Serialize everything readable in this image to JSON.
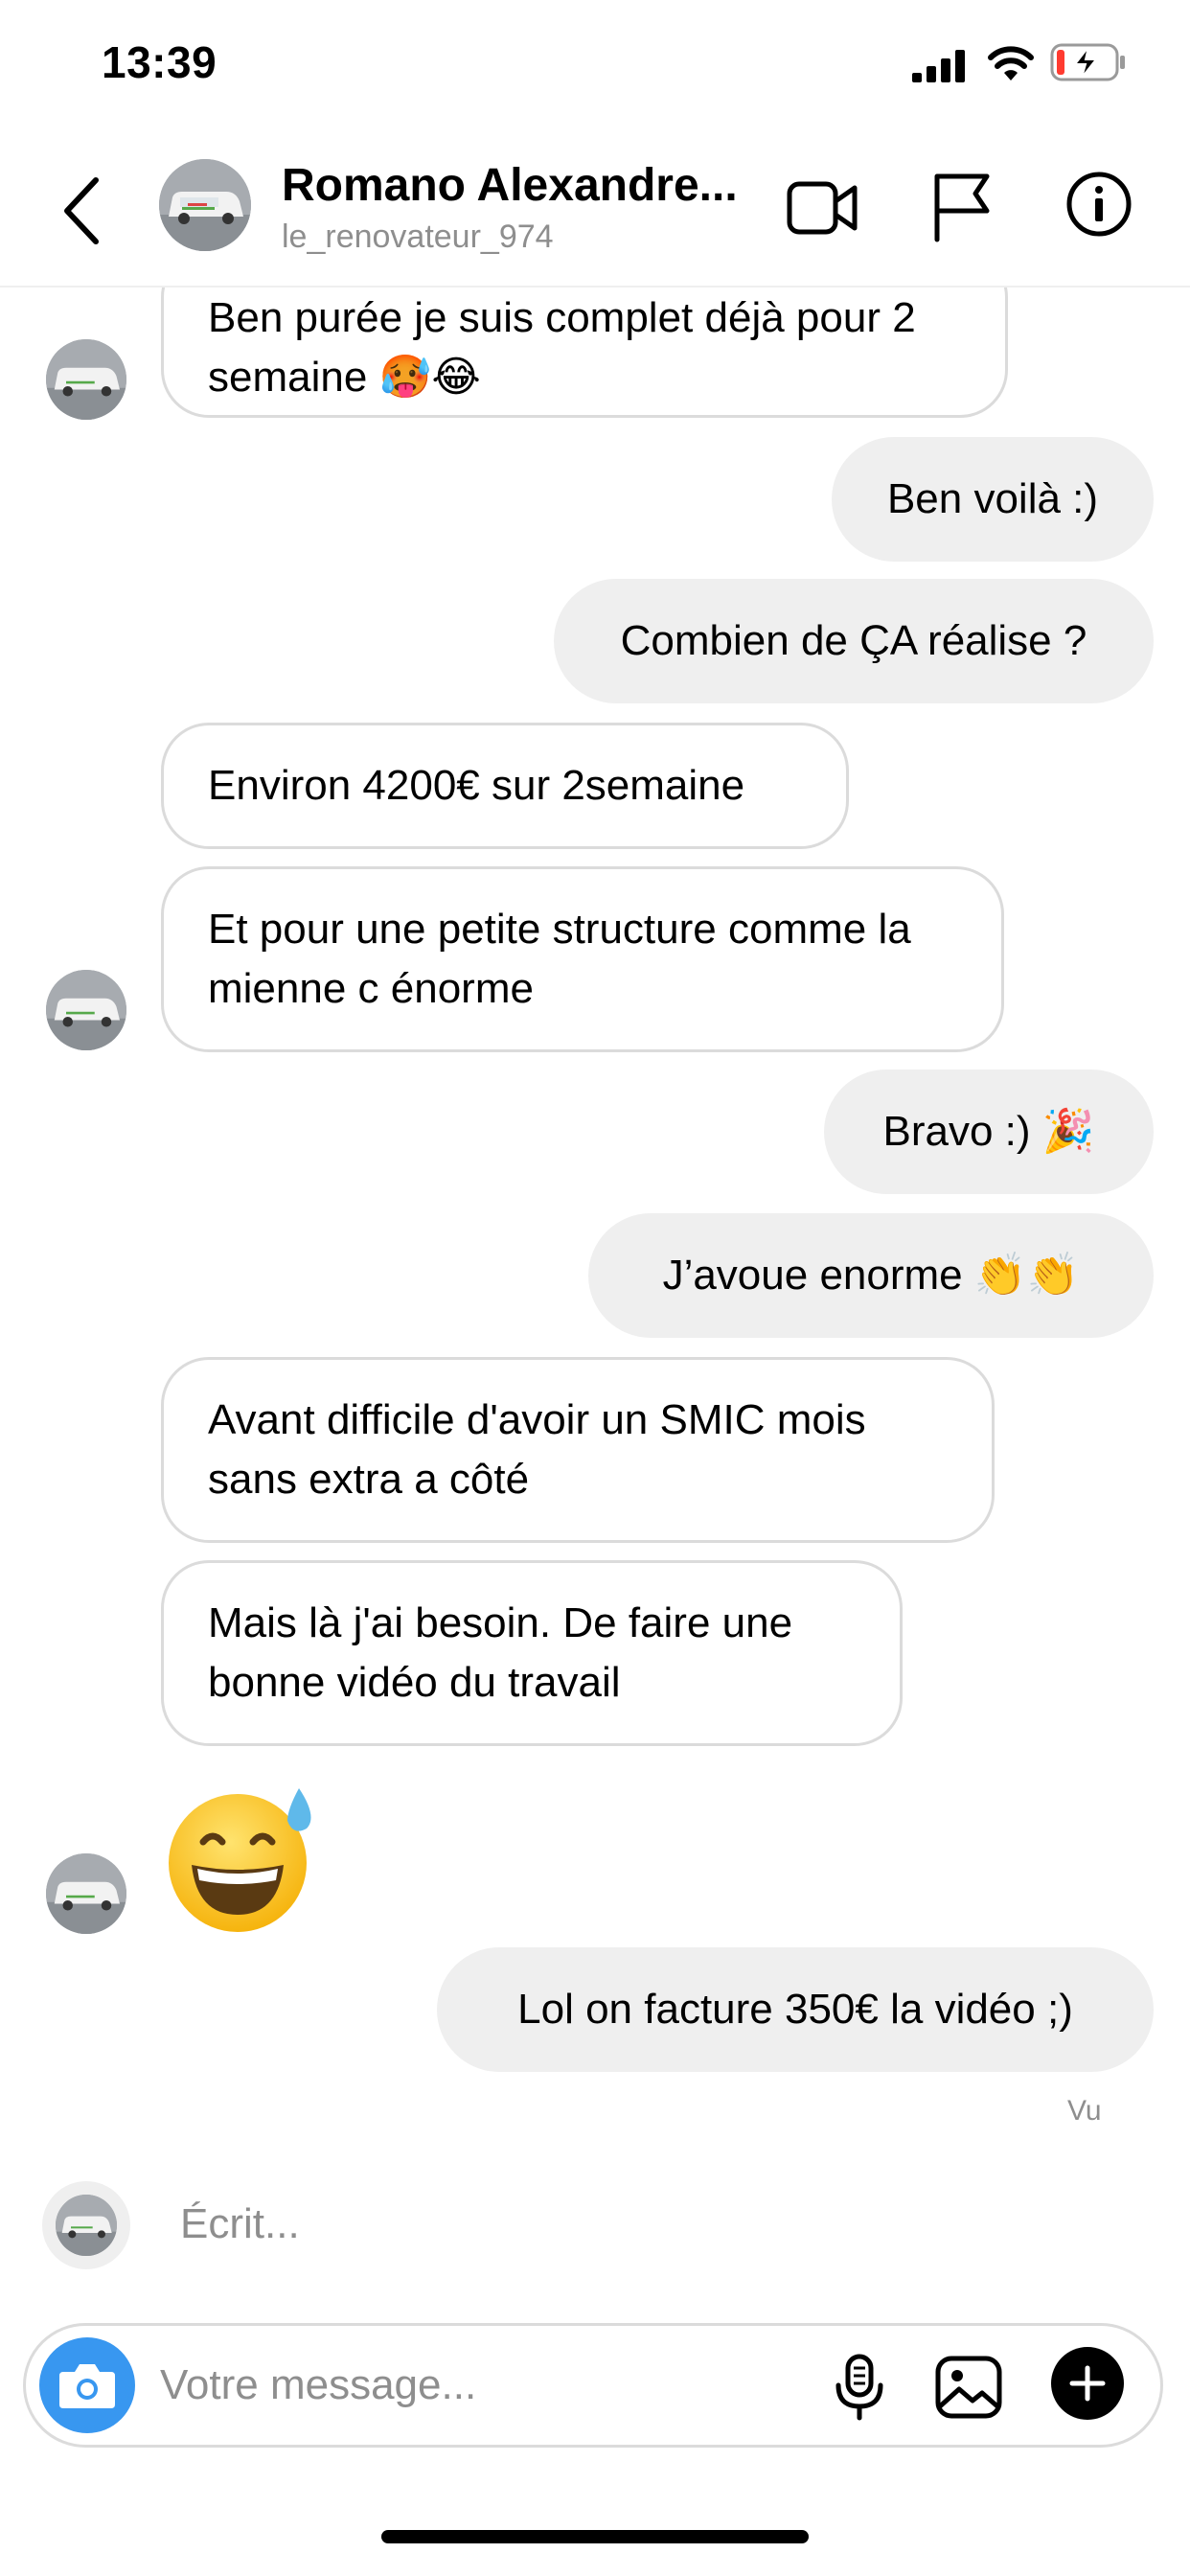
{
  "status_bar": {
    "time": "13:39",
    "icons": [
      "cellular-signal-icon",
      "wifi-icon",
      "battery-charging-icon"
    ],
    "battery_color": "#ff3b30"
  },
  "header": {
    "name": "Romano Alexandre...",
    "username": "le_renovateur_974",
    "icons": [
      "back-chevron-icon",
      "video-camera-icon",
      "flag-icon",
      "info-icon"
    ]
  },
  "messages": [
    {
      "from": "them",
      "text": "Ben purée je suis complet déjà pour 2 semaine 🥵😂"
    },
    {
      "from": "me",
      "text": "Ben voilà :)"
    },
    {
      "from": "me",
      "text": "Combien de ÇA réalise ?"
    },
    {
      "from": "them",
      "text": "Environ 4200€ sur 2semaine"
    },
    {
      "from": "them",
      "text": "Et pour une petite structure comme la mienne c énorme"
    },
    {
      "from": "me",
      "text": "Bravo :) 🎉"
    },
    {
      "from": "me",
      "text": "J’avoue enorme 👏👏"
    },
    {
      "from": "them",
      "text": "Avant difficile d'avoir un SMIC mois sans extra a côté"
    },
    {
      "from": "them",
      "text": "Mais là j'ai besoin. De faire une bonne vidéo du travail"
    },
    {
      "from": "them",
      "emoji": "grinning-face-with-sweat"
    },
    {
      "from": "me",
      "text": "Lol on facture 350€ la vidéo ;)"
    }
  ],
  "seen_label": "Vu",
  "typing_label": "Écrit...",
  "composer": {
    "placeholder": "Votre message...",
    "icons": [
      "camera-icon",
      "microphone-icon",
      "gallery-icon",
      "plus-icon"
    ],
    "camera_color": "#3897f0"
  }
}
